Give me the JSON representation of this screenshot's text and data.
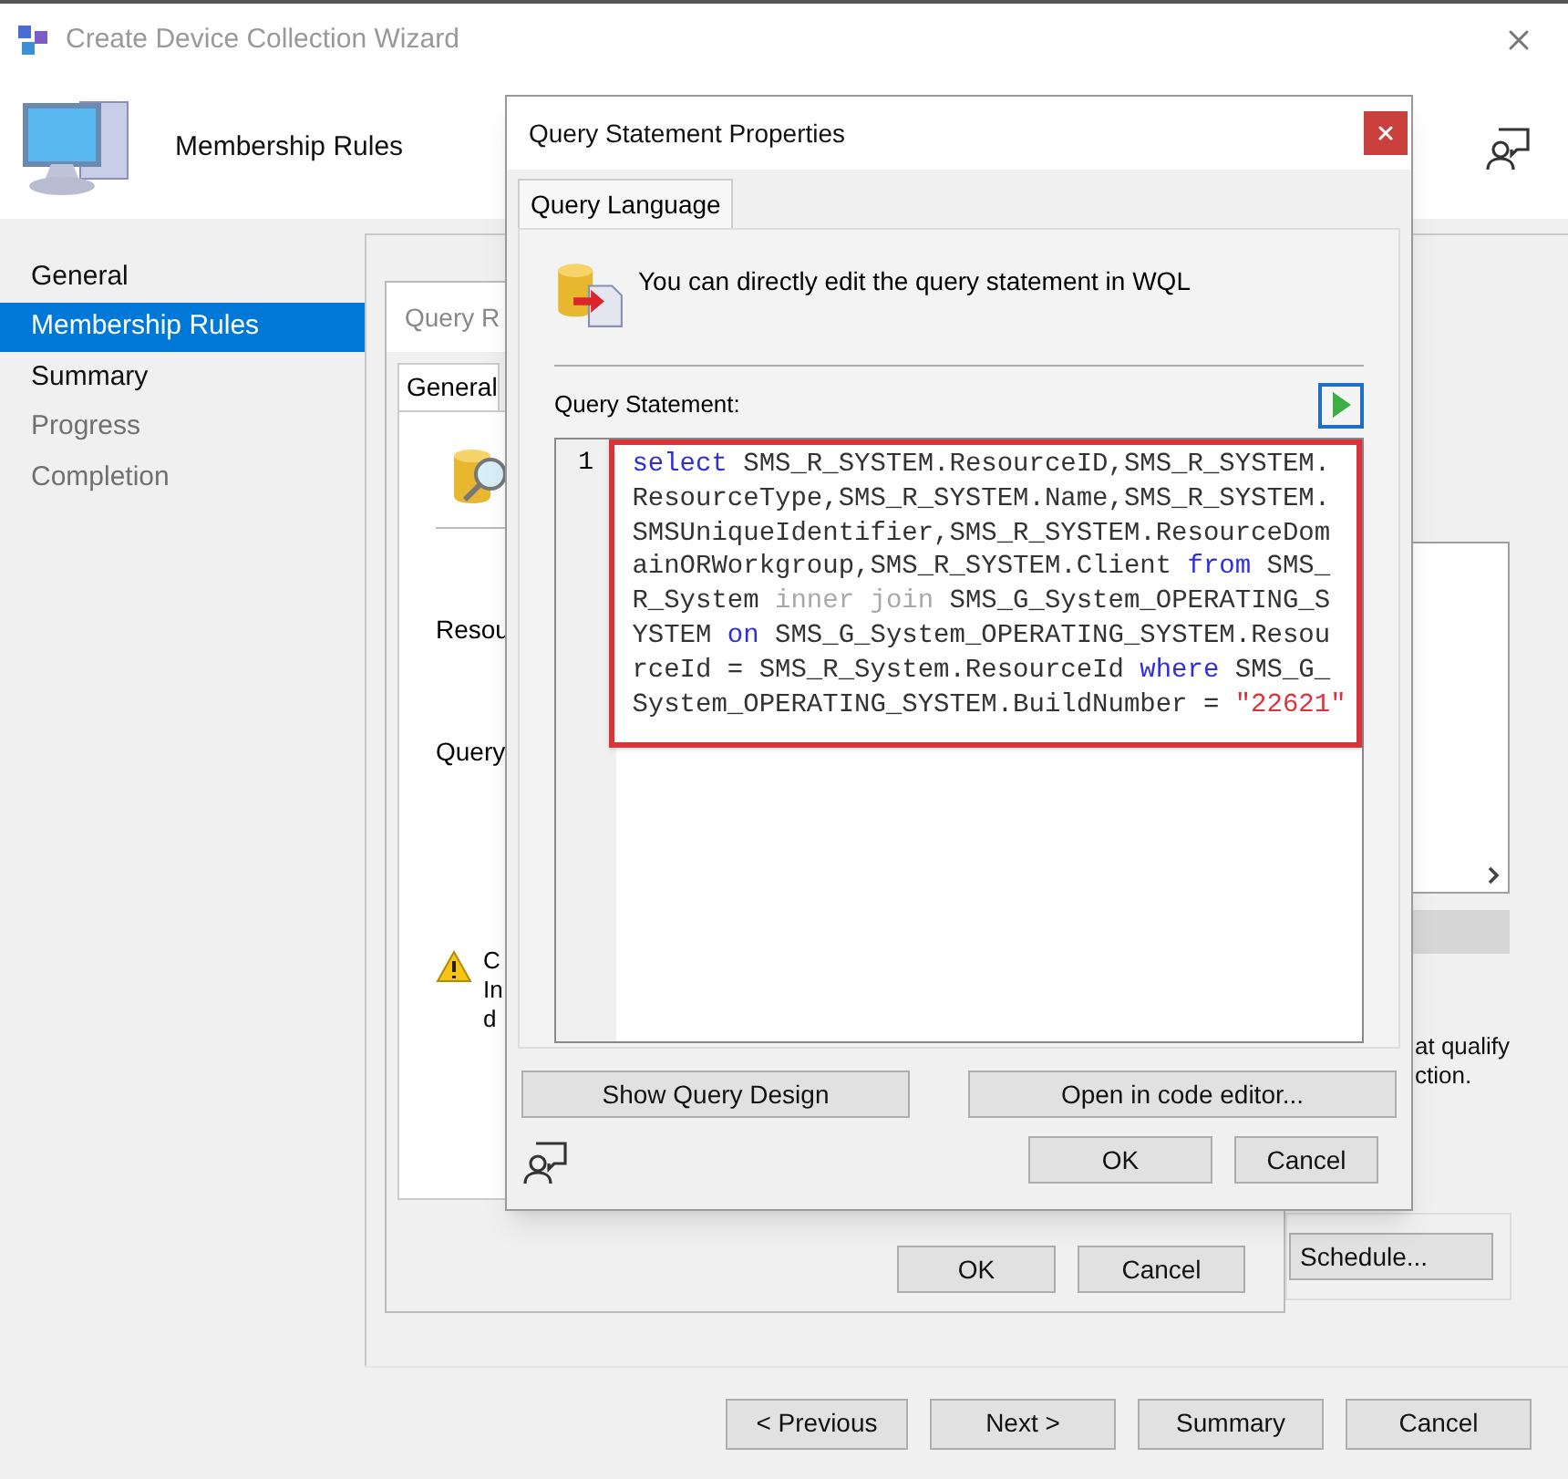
{
  "wizard": {
    "title": "Create Device Collection Wizard",
    "header": "Membership Rules",
    "steps": [
      {
        "label": "General",
        "selected": false,
        "disabled": false
      },
      {
        "label": "Membership Rules",
        "selected": true,
        "disabled": false
      },
      {
        "label": "Summary",
        "selected": false,
        "disabled": false
      },
      {
        "label": "Progress",
        "selected": false,
        "disabled": true
      },
      {
        "label": "Completion",
        "selected": false,
        "disabled": true
      }
    ],
    "side_text": [
      "at qualify",
      "ction."
    ],
    "schedule_button": "Schedule...",
    "nav_buttons": [
      "< Previous",
      "Next >",
      "Summary",
      "Cancel"
    ]
  },
  "rule_dialog": {
    "title": "Query R",
    "tab": "General",
    "labels": [
      "Resou",
      "Query"
    ],
    "warning_lines": [
      "C",
      "In",
      "d"
    ],
    "buttons": [
      "OK",
      "Cancel"
    ]
  },
  "statement_dialog": {
    "title": "Query Statement Properties",
    "tabs": [
      {
        "label": "Query Language",
        "selected": true
      }
    ],
    "description": "You can directly edit the query statement in WQL",
    "editor_label": "Query Statement:",
    "line_number": "1",
    "code_lines": [
      [
        {
          "text": "select",
          "kind": "keyword"
        },
        {
          "text": " SMS_R_SYSTEM.ResourceID,SMS_R_SYSTEM.",
          "kind": "plain"
        }
      ],
      [
        {
          "text": "ResourceType,SMS_R_SYSTEM.Name,SMS_R_SYSTEM.",
          "kind": "plain"
        }
      ],
      [
        {
          "text": "SMSUniqueIdentifier,SMS_R_SYSTEM.ResourceDom",
          "kind": "plain"
        }
      ],
      [
        {
          "text": "ainORWorkgroup,SMS_R_SYSTEM.Client ",
          "kind": "plain"
        },
        {
          "text": "from",
          "kind": "keyword"
        },
        {
          "text": " SMS_",
          "kind": "plain"
        }
      ],
      [
        {
          "text": "R_System ",
          "kind": "plain"
        },
        {
          "text": "inner join",
          "kind": "muted"
        },
        {
          "text": " SMS_G_System_OPERATING_S",
          "kind": "plain"
        }
      ],
      [
        {
          "text": "YSTEM ",
          "kind": "plain"
        },
        {
          "text": "on",
          "kind": "keyword"
        },
        {
          "text": " SMS_G_System_OPERATING_SYSTEM.Resou",
          "kind": "plain"
        }
      ],
      [
        {
          "text": "rceId = SMS_R_System.ResourceId ",
          "kind": "plain"
        },
        {
          "text": "where",
          "kind": "keyword"
        },
        {
          "text": " SMS_G_",
          "kind": "plain"
        }
      ],
      [
        {
          "text": "System_OPERATING_SYSTEM.BuildNumber = ",
          "kind": "plain"
        },
        {
          "text": "\"22621\"",
          "kind": "string"
        }
      ]
    ],
    "buttons": [
      "Show Query Design",
      "Open in code editor..."
    ],
    "dialog_buttons": [
      "OK",
      "Cancel"
    ]
  }
}
